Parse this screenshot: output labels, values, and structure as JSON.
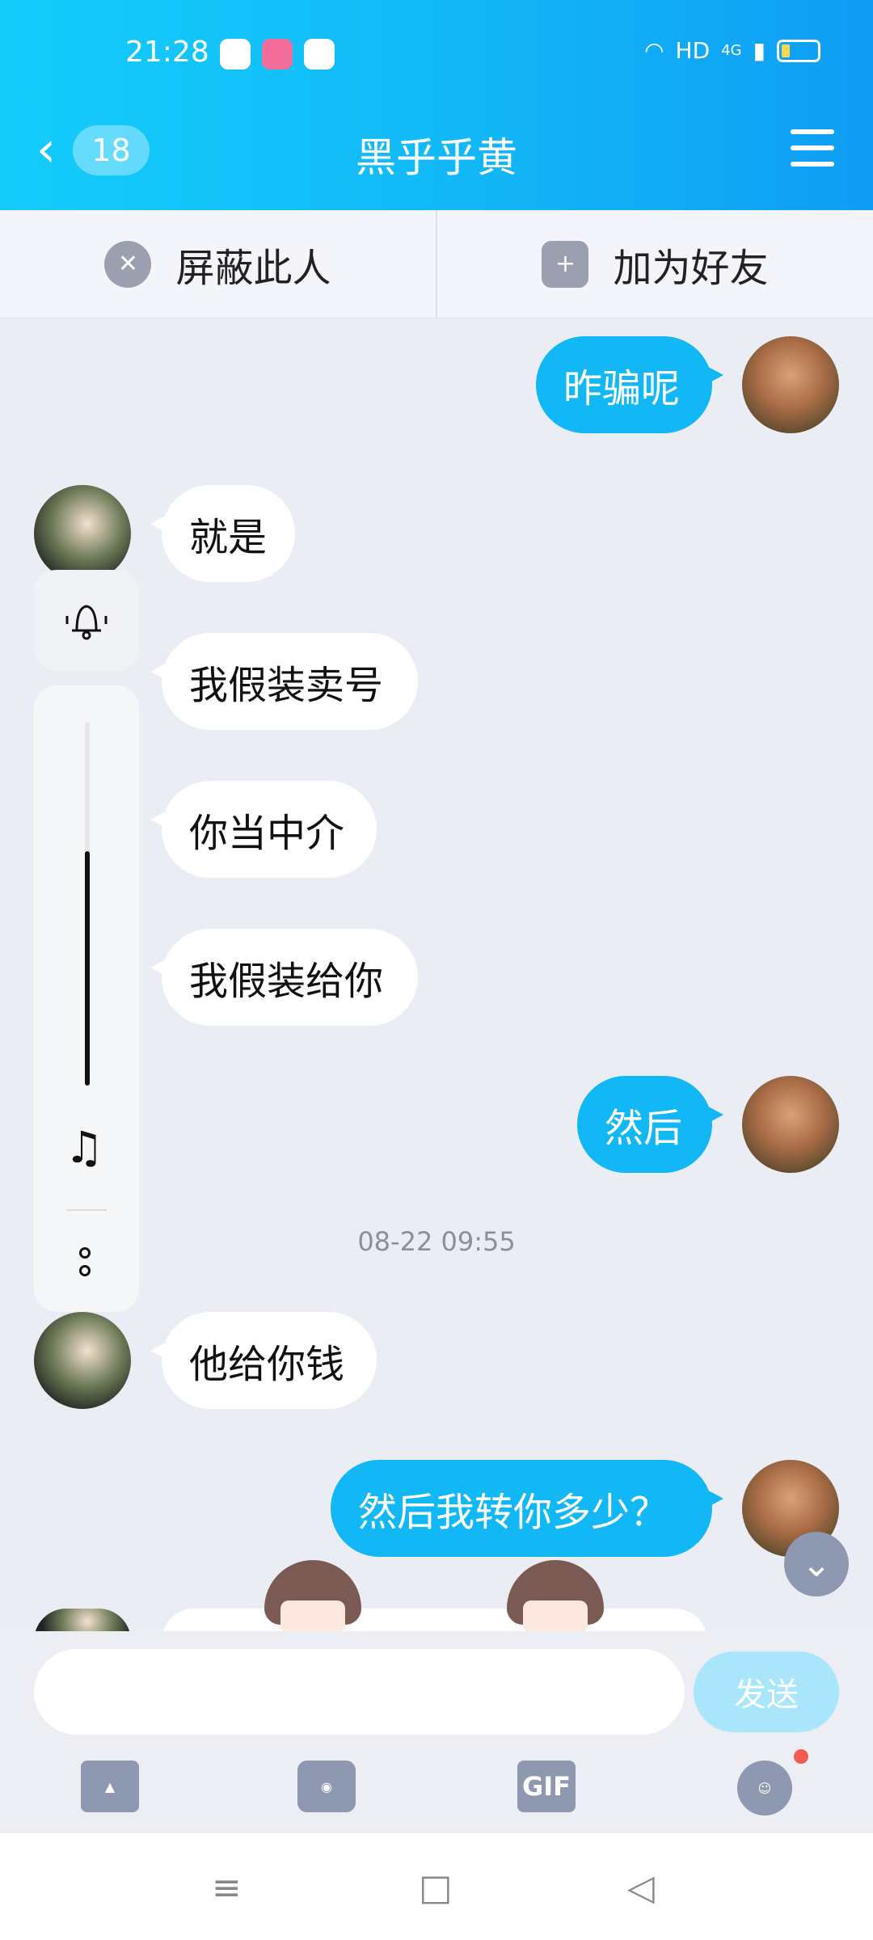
{
  "status": {
    "time": "21:28",
    "network": "HD",
    "signal": "4G"
  },
  "header": {
    "back_icon": "chevron-left-icon",
    "unread": "18",
    "title": "黑乎乎黄",
    "menu_icon": "hamburger-menu-icon"
  },
  "actions": {
    "block_label": "屏蔽此人",
    "add_label": "加为好友"
  },
  "messages": [
    {
      "side": "me",
      "text": "昨骗呢"
    },
    {
      "side": "other",
      "text": "就是"
    },
    {
      "side": "other",
      "text": "我假装卖号"
    },
    {
      "side": "other",
      "text": "你当中介"
    },
    {
      "side": "other",
      "text": "我假装给你"
    },
    {
      "side": "me",
      "text": "然后"
    },
    {
      "side": "other",
      "text": "他给你钱"
    },
    {
      "side": "me",
      "text": "然后我转你多少？"
    }
  ],
  "timestamp": "08-22 09:55",
  "input": {
    "placeholder": "",
    "send_label": "发送"
  },
  "tools": {
    "gif_label": "GIF"
  },
  "colors": {
    "header": "#12b7f7",
    "my_bubble": "#12b7f5",
    "background": "#ebedf5"
  }
}
